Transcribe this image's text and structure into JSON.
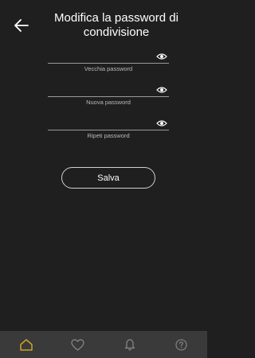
{
  "header": {
    "title_line1": "Modifica la password di",
    "title_line2": "condivisione",
    "back_icon": "arrow-left-icon"
  },
  "form": {
    "fields": [
      {
        "label": "Vecchia password",
        "value": "",
        "icon": "eye-icon"
      },
      {
        "label": "Nuova password",
        "value": "",
        "icon": "eye-icon"
      },
      {
        "label": "Ripeti password",
        "value": "",
        "icon": "eye-icon"
      }
    ],
    "save_label": "Salva"
  },
  "tabbar": {
    "items": [
      {
        "icon": "home-icon",
        "active": true
      },
      {
        "icon": "heart-icon",
        "active": false
      },
      {
        "icon": "bell-icon",
        "active": false
      },
      {
        "icon": "help-icon",
        "active": false
      }
    ]
  },
  "colors": {
    "background": "#1f1f1f",
    "tabbar": "#3a3a3a",
    "accent": "#e5b623",
    "inactive_icon": "#8a8a8a"
  }
}
